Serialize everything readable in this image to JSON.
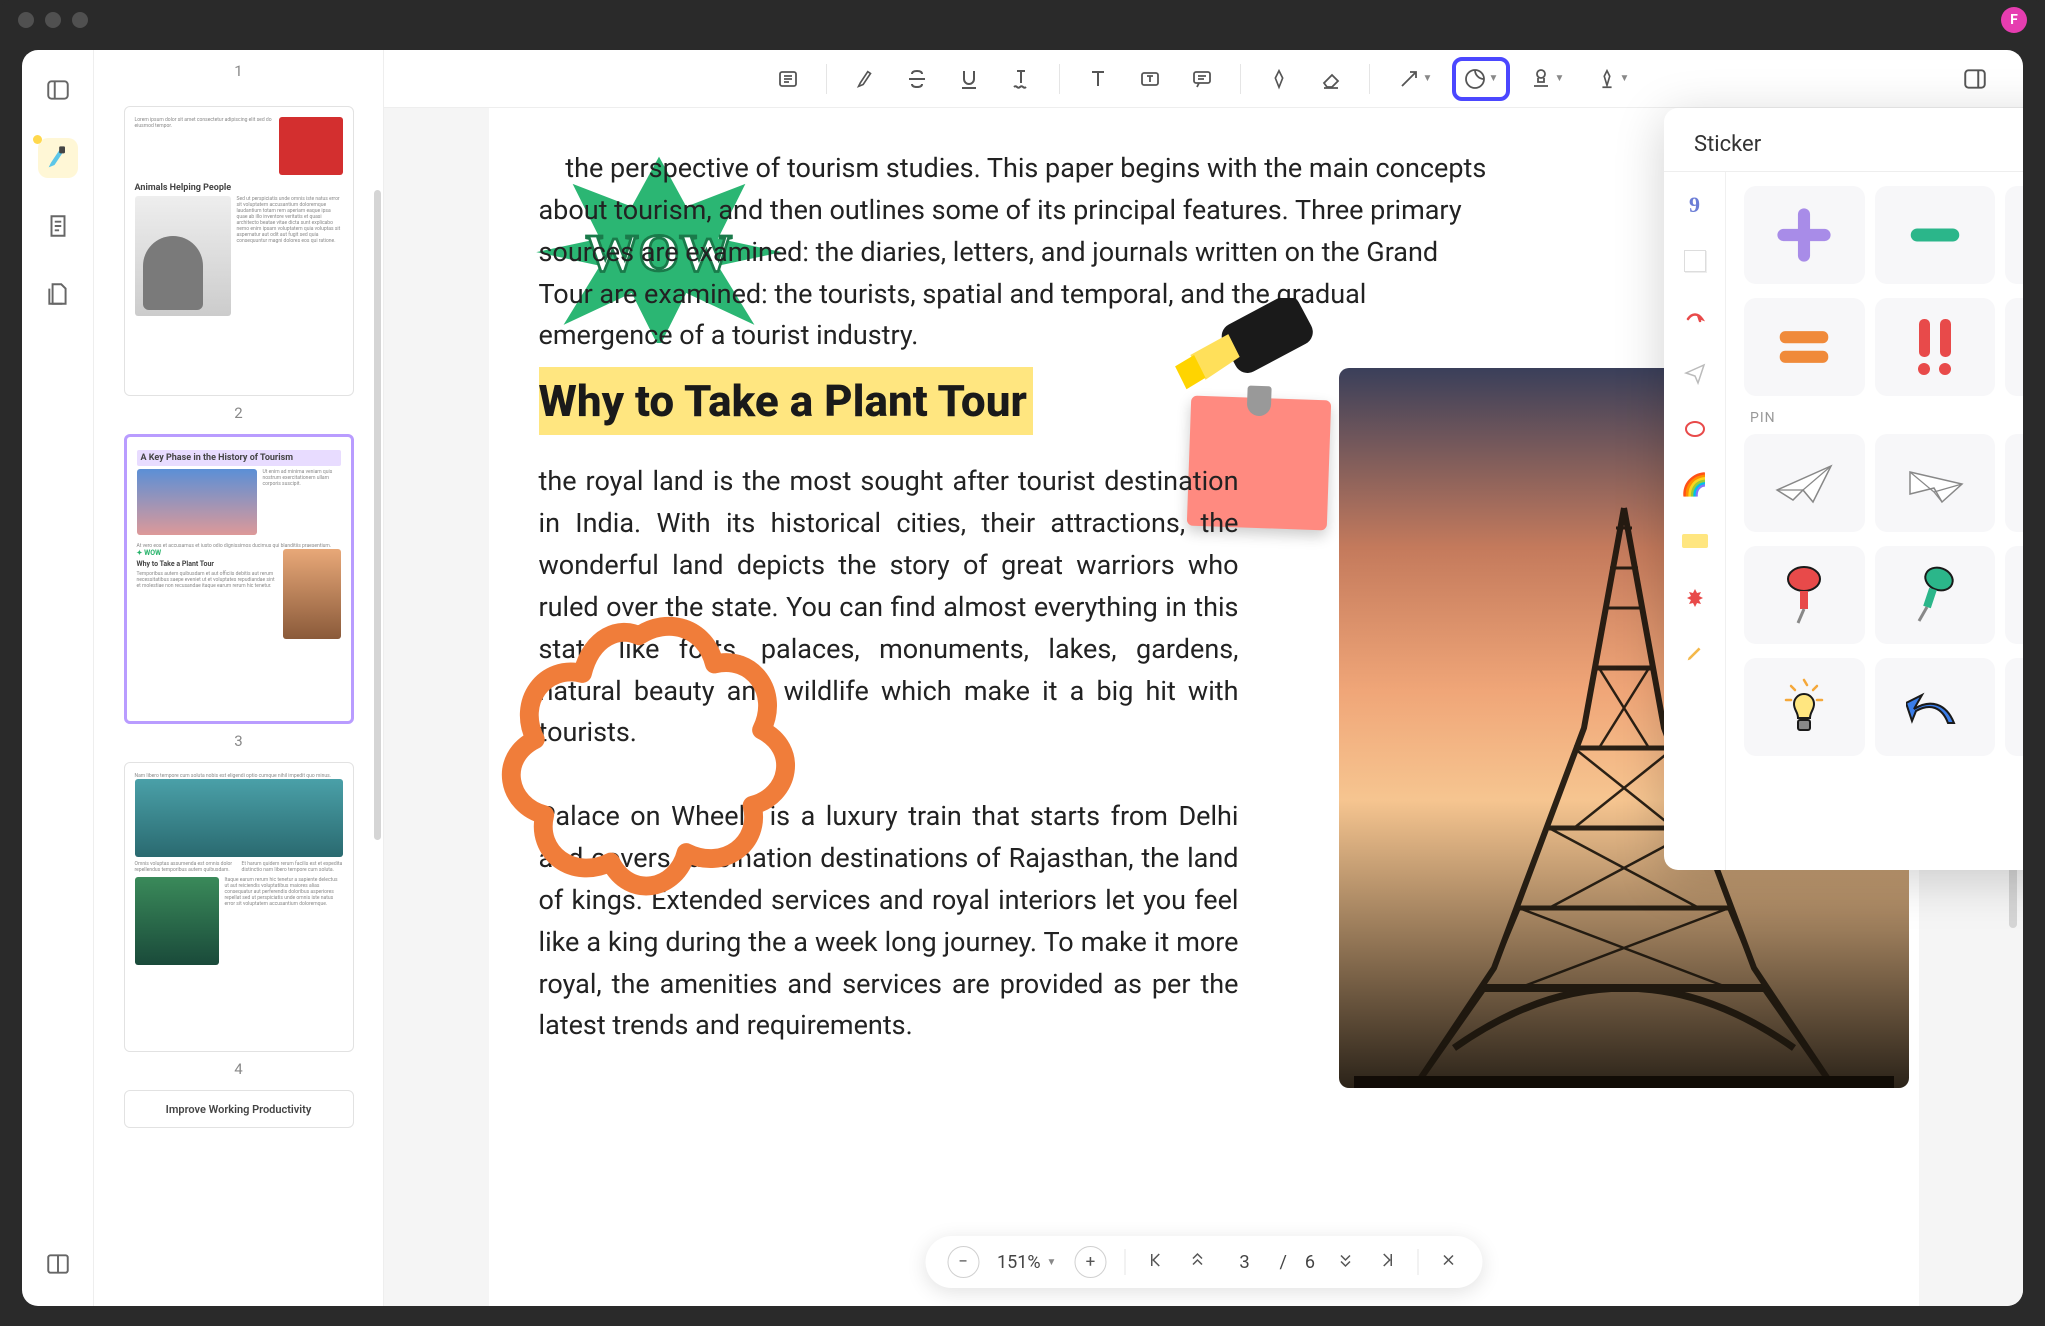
{
  "avatar_letter": "F",
  "thumbs": {
    "nums": [
      "1",
      "2",
      "3",
      "4"
    ],
    "p2_heading": "Animals Helping People",
    "p3_heading": "A Key Phase in the History of Tourism",
    "p3_sub": "Why to Take a Plant Tour",
    "p5_heading": "Improve Working Productivity"
  },
  "doc": {
    "intro_1": "the perspective of tourism studies. This paper begins with the main concepts",
    "intro_2": "about tourism, and then outlines some of its principal features. Three primary",
    "intro_3": "sources are examined: the diaries, letters, and journals written on the Grand",
    "intro_4": "Tour are examined: the tourists, spatial and temporal, and the gradual",
    "intro_5": "emergence of a tourist industry.",
    "h2": "Why to Take a Plant Tour",
    "p1": "the royal land is the most sought after tourist destination in India. With its historical cities, their attractions, the wonderful land depicts the story of great warriors who ruled over the state. You can find almost everything in this state like forts, palaces, monuments, lakes, gardens, natural beauty and wildlife which make it a big hit with tourists.",
    "p2": "Palace on Wheels is a luxury train that starts from Delhi and covers fascination destinations of Rajasthan, the land of kings. Extended services and royal interiors let you feel like a king during the a week long journey. To make it more royal, the amenities and services are provided as per the latest trends and requirements.",
    "wow_text": "WOW"
  },
  "sticker_panel": {
    "title": "Sticker",
    "section_label": "PIN",
    "side_cat_number": "9"
  },
  "footer": {
    "zoom": "151%",
    "page_current": "3",
    "page_sep": "/",
    "page_total": "6"
  }
}
